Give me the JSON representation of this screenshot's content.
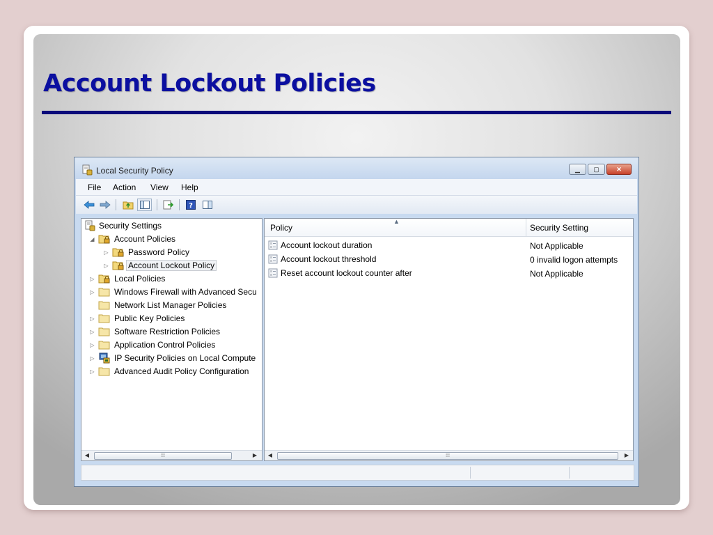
{
  "slide": {
    "title": "Account Lockout Policies"
  },
  "window": {
    "title": "Local Security Policy",
    "menu": [
      "File",
      "Action",
      "View",
      "Help"
    ],
    "tree": [
      {
        "label": "Security Settings",
        "level": 0,
        "expander": "",
        "icon": "settings-icon"
      },
      {
        "label": "Account Policies",
        "level": 1,
        "expander": "◢",
        "icon": "folder-lock-icon"
      },
      {
        "label": "Password Policy",
        "level": 2,
        "expander": "▷",
        "icon": "folder-lock-icon"
      },
      {
        "label": "Account Lockout Policy",
        "level": 2,
        "expander": "▷",
        "icon": "folder-lock-icon",
        "selected": true
      },
      {
        "label": "Local Policies",
        "level": 1,
        "expander": "▷",
        "icon": "folder-lock-icon"
      },
      {
        "label": "Windows Firewall with Advanced Secu",
        "level": 1,
        "expander": "▷",
        "icon": "folder-icon"
      },
      {
        "label": "Network List Manager Policies",
        "level": 1,
        "expander": "",
        "icon": "folder-icon"
      },
      {
        "label": "Public Key Policies",
        "level": 1,
        "expander": "▷",
        "icon": "folder-icon"
      },
      {
        "label": "Software Restriction Policies",
        "level": 1,
        "expander": "▷",
        "icon": "folder-icon"
      },
      {
        "label": "Application Control Policies",
        "level": 1,
        "expander": "▷",
        "icon": "folder-icon"
      },
      {
        "label": "IP Security Policies on Local Compute",
        "level": 1,
        "expander": "▷",
        "icon": "ipsec-icon"
      },
      {
        "label": "Advanced Audit Policy Configuration",
        "level": 1,
        "expander": "▷",
        "icon": "folder-icon"
      }
    ],
    "list": {
      "columns": {
        "policy": "Policy",
        "setting": "Security Setting"
      },
      "rows": [
        {
          "policy": "Account lockout duration",
          "setting": "Not Applicable"
        },
        {
          "policy": "Account lockout threshold",
          "setting": "0 invalid logon attempts"
        },
        {
          "policy": "Reset account lockout counter after",
          "setting": "Not Applicable"
        }
      ]
    }
  }
}
